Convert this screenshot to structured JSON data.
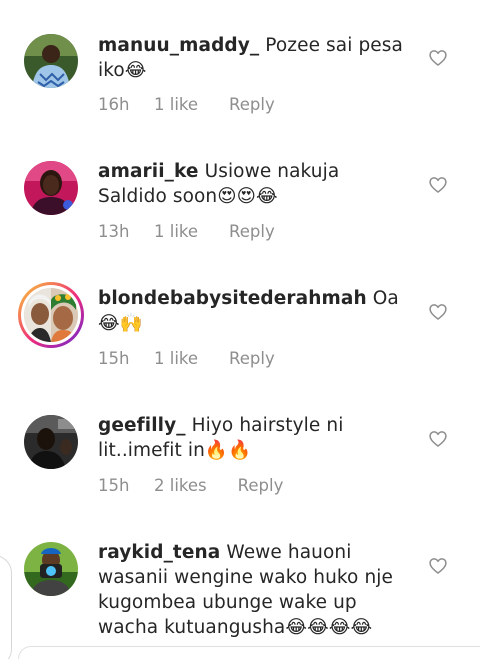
{
  "comments": [
    {
      "username": "manuu_maddy_",
      "text": "Pozee sai pesa iko😂",
      "time": "16h",
      "likes": "1 like",
      "reply": "Reply"
    },
    {
      "username": "amarii_ke",
      "text": "Usiowe nakuja Saldido soon😍😍😂",
      "time": "13h",
      "likes": "1 like",
      "reply": "Reply"
    },
    {
      "username": "blondebabysitederahmah",
      "text": "Oa 😂🙌",
      "time": "15h",
      "likes": "1 like",
      "reply": "Reply"
    },
    {
      "username": "geefilly_",
      "text": "Hiyo hairstyle ni lit..imefit in🔥🔥",
      "time": "15h",
      "likes": "2 likes",
      "reply": "Reply"
    },
    {
      "username": "raykid_tena",
      "text": "Wewe hauoni wasanii wengine wako huko nje kugombea ubunge wake up wacha kutuangusha😂😂😂😂",
      "time": "",
      "likes": "",
      "reply": ""
    }
  ],
  "icons": {
    "like": "heart-outline-icon"
  },
  "colors": {
    "text": "#262626",
    "meta": "#8e8e8e",
    "story_ring_start": "#f9ce34",
    "story_ring_end": "#ee2a7b"
  }
}
